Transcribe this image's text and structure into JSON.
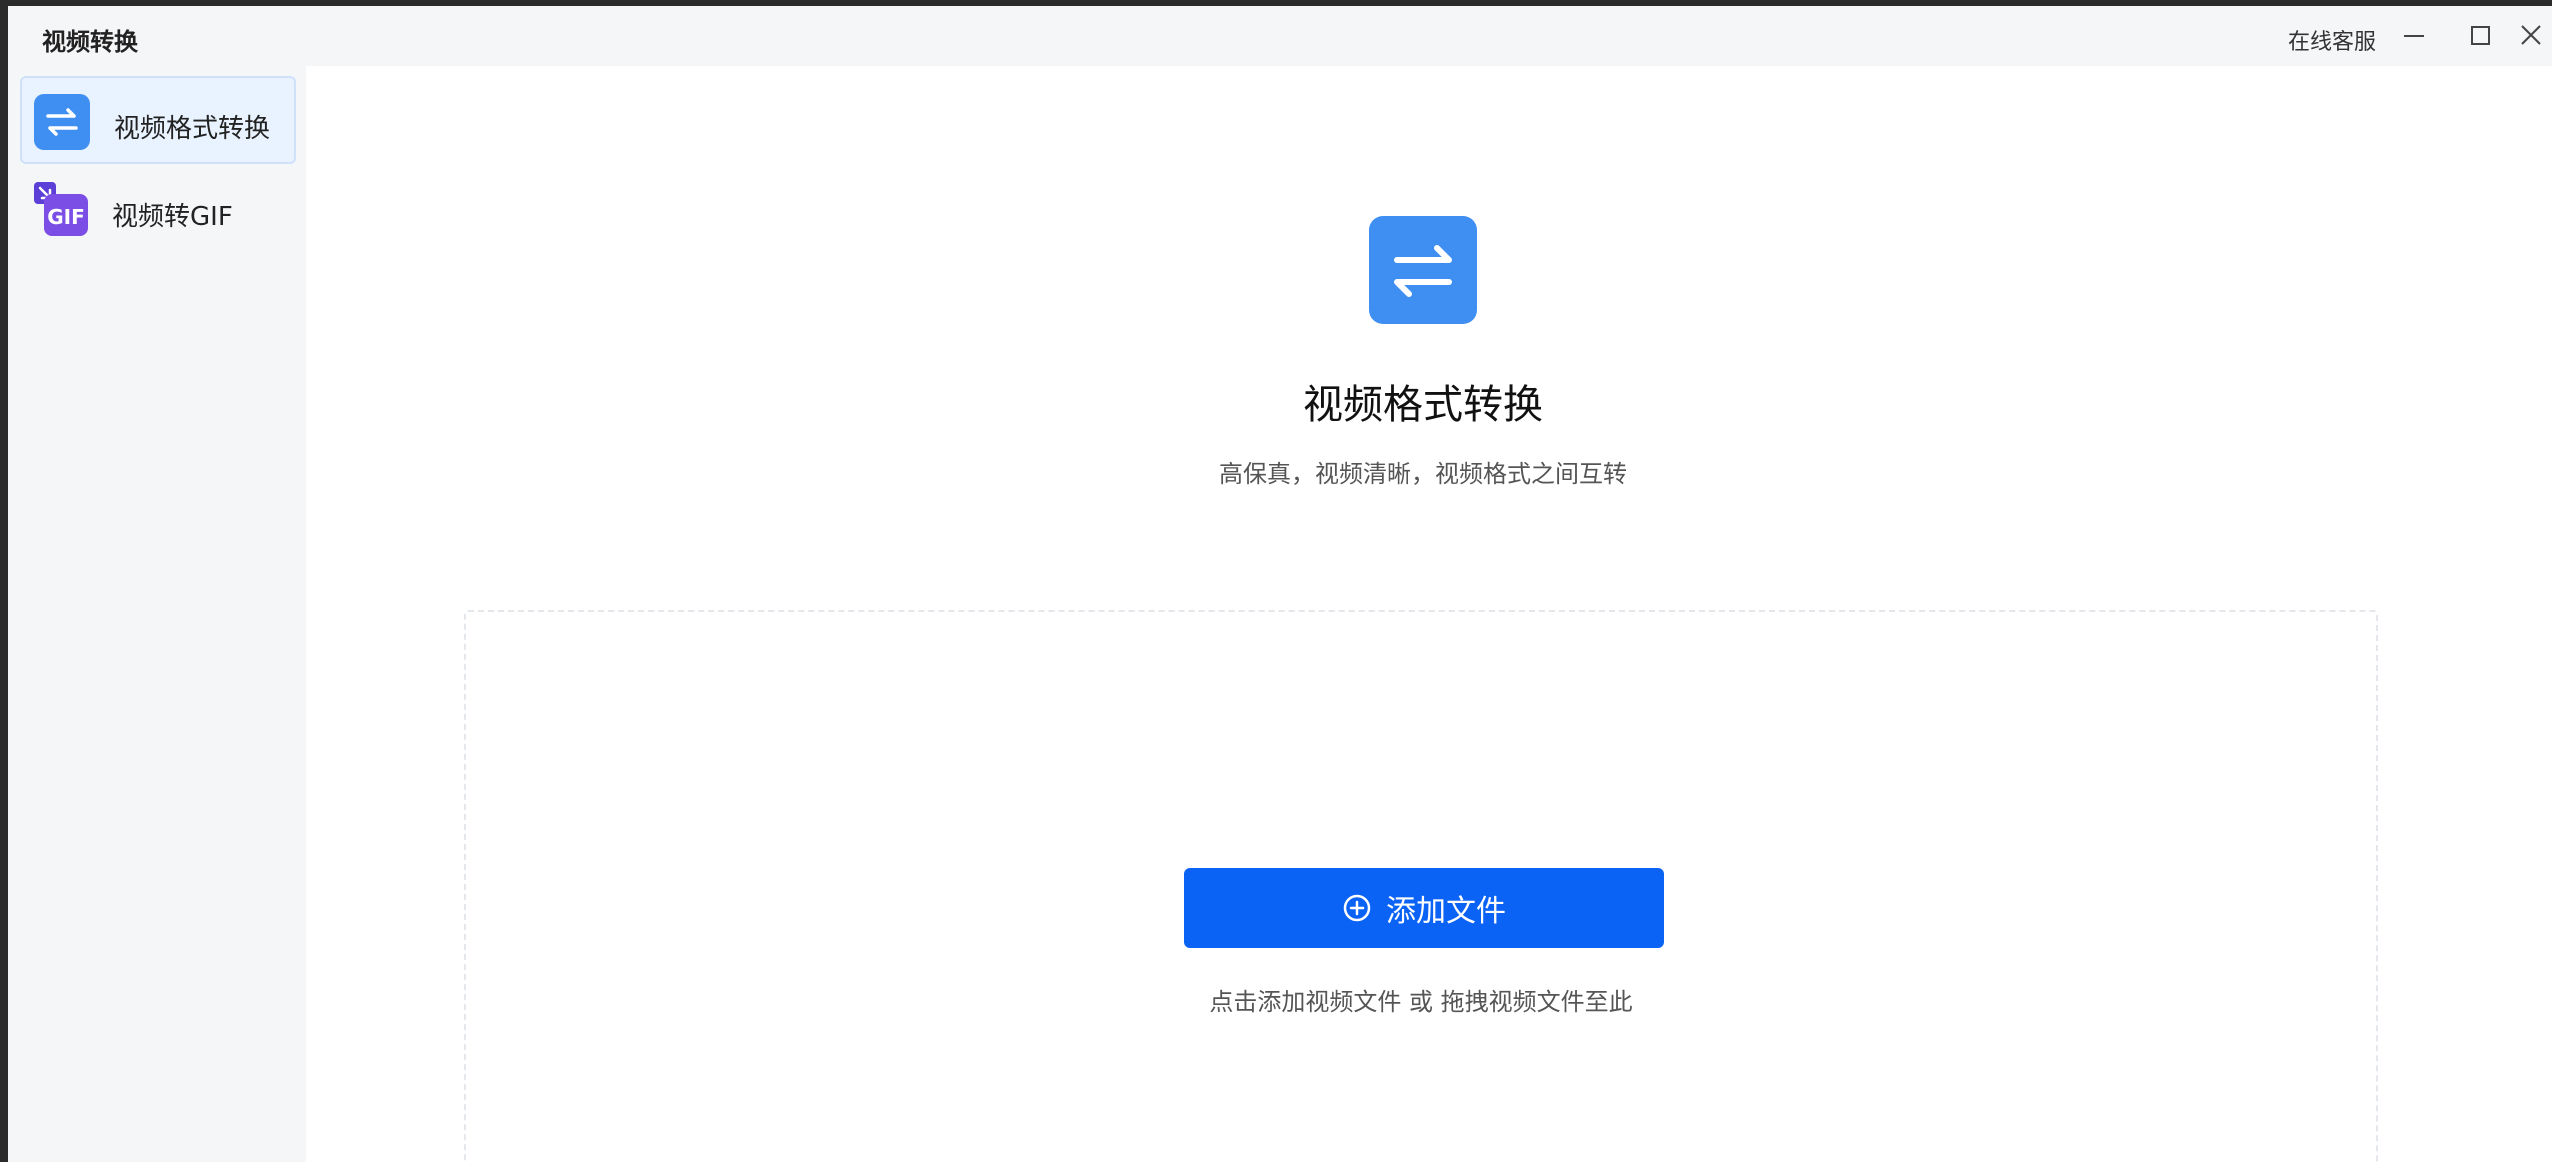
{
  "app": {
    "title": "视频转换"
  },
  "titlebar": {
    "support_label": "在线客服"
  },
  "sidebar": {
    "items": [
      {
        "label": "视频格式转换",
        "icon": "swap-arrows-icon",
        "active": true
      },
      {
        "label": "视频转GIF",
        "icon": "gif-icon",
        "active": false
      }
    ]
  },
  "main": {
    "icon": "swap-arrows-icon",
    "title": "视频格式转换",
    "subtitle": "高保真，视频清晰，视频格式之间互转",
    "add_button_label": "添加文件",
    "drop_hint": "点击添加视频文件 或 拖拽视频文件至此"
  },
  "colors": {
    "accent": "#0b63f6",
    "icon_blue": "#3f8ff2",
    "gif_purple": "#7b4fe6"
  }
}
